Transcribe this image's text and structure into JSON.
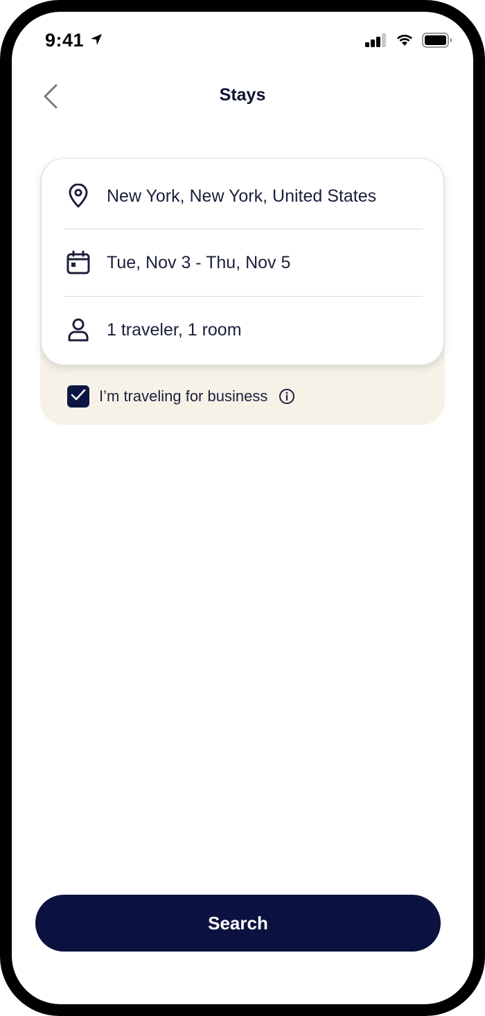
{
  "status_bar": {
    "time": "9:41",
    "icons": [
      "location-arrow-icon",
      "cellular-signal-icon",
      "wifi-icon",
      "battery-icon"
    ]
  },
  "header": {
    "title": "Stays",
    "back_icon": "chevron-left-icon"
  },
  "search_card": {
    "location": {
      "icon": "map-pin-icon",
      "value": "New York, New York, United States"
    },
    "dates": {
      "icon": "calendar-icon",
      "value": "Tue, Nov 3 - Thu, Nov 5"
    },
    "travelers": {
      "icon": "person-icon",
      "value": "1 traveler, 1 room"
    }
  },
  "business": {
    "checked": true,
    "label": "I’m traveling for business",
    "info_icon": "info-icon"
  },
  "search_button": {
    "label": "Search"
  },
  "colors": {
    "primary_navy": "#0c1240",
    "panel_beige": "#f6f2e8",
    "text_dark": "#1b1f3b"
  }
}
